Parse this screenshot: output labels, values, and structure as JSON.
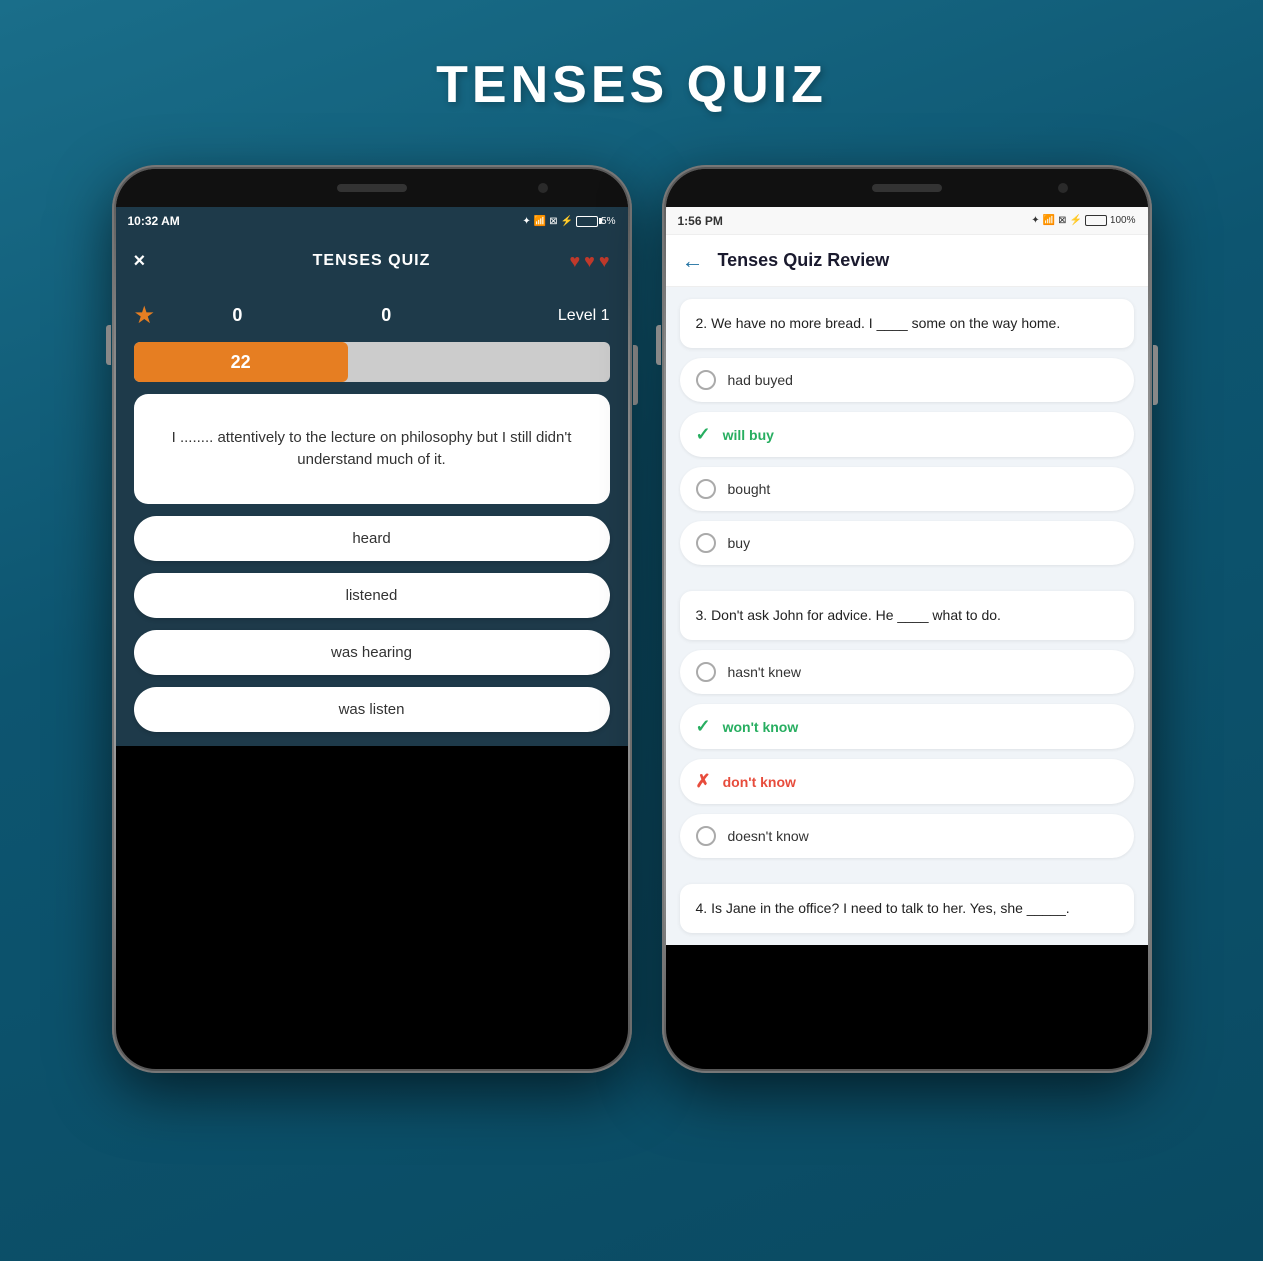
{
  "page": {
    "title": "TENSES QUIZ",
    "background_color": "#0d5570"
  },
  "left_phone": {
    "status_bar": {
      "time": "10:32 AM",
      "battery_percent": "5%",
      "battery_level": "low"
    },
    "app_bar": {
      "title": "TENSES QUIZ",
      "close_label": "×"
    },
    "hearts": [
      "♥",
      "♥",
      "♥"
    ],
    "score": {
      "star_icon": "★",
      "score1": "0",
      "score2": "0",
      "level": "Level 1"
    },
    "progress": {
      "value": "22",
      "percent": 45
    },
    "question": "I ........ attentively to the lecture on philosophy but I still didn't understand much of it.",
    "answers": [
      {
        "label": "heard"
      },
      {
        "label": "listened"
      },
      {
        "label": "was hearing"
      },
      {
        "label": "was listen"
      }
    ]
  },
  "right_phone": {
    "status_bar": {
      "time": "1:56 PM",
      "battery_percent": "100%",
      "battery_level": "full"
    },
    "app_bar": {
      "back_icon": "←",
      "title": "Tenses Quiz Review"
    },
    "question2": {
      "text": "2. We have no more bread. I ____ some on the way home.",
      "options": [
        {
          "label": "had buyed",
          "state": "neutral"
        },
        {
          "label": "will buy",
          "state": "correct"
        },
        {
          "label": "bought",
          "state": "neutral"
        },
        {
          "label": "buy",
          "state": "neutral"
        }
      ]
    },
    "question3": {
      "text": "3. Don't ask John for advice. He ____ what to do.",
      "options": [
        {
          "label": "hasn't knew",
          "state": "neutral"
        },
        {
          "label": "won't know",
          "state": "correct"
        },
        {
          "label": "don't know",
          "state": "wrong"
        },
        {
          "label": "doesn't know",
          "state": "neutral"
        }
      ]
    },
    "question4": {
      "text": "4. Is Jane in the office? I need to talk to her. Yes, she _____."
    }
  }
}
